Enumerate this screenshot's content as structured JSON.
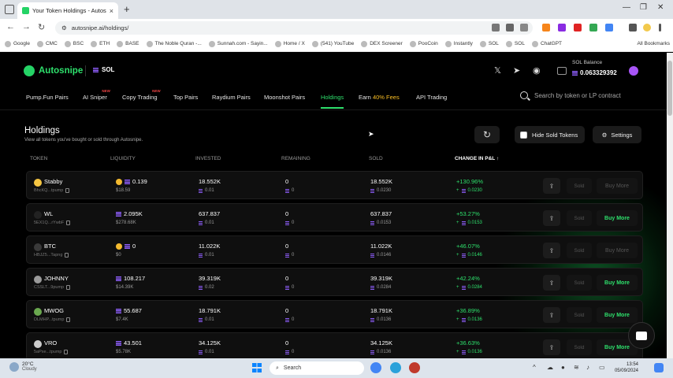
{
  "browser": {
    "tab_title": "Your Token Holdings - Autosnipe",
    "tab_close": "×",
    "new_tab": "+",
    "url": "autosnipe.ai/holdings/",
    "bookmarks": [
      "Google",
      "CMC",
      "BSC",
      "ETH",
      "BASE",
      "The Noble Quran -...",
      "Sunnah.com - Sayin...",
      "Home / X",
      "(541) YouTube",
      "DEX Screener",
      "PooCoin",
      "Instantly",
      "SOL",
      "SOL",
      "ChatGPT"
    ],
    "all_bookmarks": "All Bookmarks"
  },
  "header": {
    "brand": "Autosnipe",
    "chain": "SOL",
    "balance_label": "SOL Balance",
    "balance_value": "0.063329392"
  },
  "nav": {
    "items": [
      {
        "label": "Pump.Fun Pairs",
        "new": ""
      },
      {
        "label": "AI Sniper",
        "new": "NEW"
      },
      {
        "label": "Copy Trading",
        "new": "NEW"
      },
      {
        "label": "Top Pairs",
        "new": ""
      },
      {
        "label": "Raydium Pairs",
        "new": ""
      },
      {
        "label": "Moonshot Pairs",
        "new": ""
      },
      {
        "label": "Holdings",
        "new": ""
      },
      {
        "label_a": "Earn ",
        "label_b": "40% Fees",
        "new": ""
      },
      {
        "label": "API Trading",
        "new": ""
      }
    ],
    "search_placeholder": "Search by token or LP contract"
  },
  "holdings": {
    "title": "Holdings",
    "subtitle": "View all tokens you've bought or sold through Autosnipe.",
    "refresh_icon": "↻",
    "hide_sold_label": "Hide Sold Tokens",
    "settings_label": "Settings",
    "settings_icon": "⚙",
    "columns": {
      "token": "TOKEN",
      "liquidity": "LIQUIDITY",
      "invested": "INVESTED",
      "remaining": "REMAINING",
      "sold": "SOLD",
      "change": "CHANGE IN P&L ↑"
    },
    "rows": [
      {
        "name": "Stabby",
        "addr": "BhcKQ...tpump",
        "liq": "0.139",
        "liq_usd": "$18.59",
        "invested": "18.552K",
        "invested_sol": "0.01",
        "remaining": "0",
        "remaining_sol": "0",
        "sold": "18.552K",
        "sold_sol": "0.0230",
        "pnl": "+130.96%",
        "pnl_sol": "0.0230",
        "sold_btn": "Sold",
        "buy_btn": "Buy More",
        "buy_enabled": false,
        "icon_color": "#f5c542",
        "bnb": true
      },
      {
        "name": "WL",
        "addr": "5EX1Q...rYwbF",
        "liq": "2.095K",
        "liq_usd": "$278.68K",
        "invested": "637.837",
        "invested_sol": "0.01",
        "remaining": "0",
        "remaining_sol": "0",
        "sold": "637.837",
        "sold_sol": "0.0153",
        "pnl": "+53.27%",
        "pnl_sol": "0.0153",
        "sold_btn": "Sold",
        "buy_btn": "Buy More",
        "buy_enabled": true,
        "icon_color": "#222222",
        "bnb": false
      },
      {
        "name": "BTC",
        "addr": "HBJZ5...Tapng",
        "liq": "0",
        "liq_usd": "$0",
        "invested": "11.022K",
        "invested_sol": "0.01",
        "remaining": "0",
        "remaining_sol": "0",
        "sold": "11.022K",
        "sold_sol": "0.0146",
        "pnl": "+46.07%",
        "pnl_sol": "0.0146",
        "sold_btn": "Sold",
        "buy_btn": "Buy More",
        "buy_enabled": false,
        "icon_color": "#3a3a3a",
        "bnb": true
      },
      {
        "name": "JOHNNY",
        "addr": "CSSLT...9pump",
        "liq": "108.217",
        "liq_usd": "$14.39K",
        "invested": "39.319K",
        "invested_sol": "0.02",
        "remaining": "0",
        "remaining_sol": "0",
        "sold": "39.319K",
        "sold_sol": "0.0284",
        "pnl": "+42.24%",
        "pnl_sol": "0.0284",
        "sold_btn": "Sold",
        "buy_btn": "Buy More",
        "buy_enabled": true,
        "icon_color": "#9a9a9a",
        "bnb": false
      },
      {
        "name": "MWOG",
        "addr": "DLMHP...tpump",
        "liq": "55.687",
        "liq_usd": "$7.4K",
        "invested": "18.791K",
        "invested_sol": "0.01",
        "remaining": "0",
        "remaining_sol": "0",
        "sold": "18.791K",
        "sold_sol": "0.0136",
        "pnl": "+36.89%",
        "pnl_sol": "0.0136",
        "sold_btn": "Sold",
        "buy_btn": "Buy More",
        "buy_enabled": true,
        "icon_color": "#6aa84f",
        "bnb": false
      },
      {
        "name": "VRO",
        "addr": "5aPxe...tpump",
        "liq": "43.501",
        "liq_usd": "$5.78K",
        "invested": "34.125K",
        "invested_sol": "0.01",
        "remaining": "0",
        "remaining_sol": "0",
        "sold": "34.125K",
        "sold_sol": "0.0136",
        "pnl": "+36.63%",
        "pnl_sol": "0.0136",
        "sold_btn": "Sold",
        "buy_btn": "Buy More",
        "buy_enabled": true,
        "icon_color": "#cccccc",
        "bnb": false
      }
    ]
  },
  "taskbar": {
    "temp": "20°C",
    "condition": "Cloudy",
    "search_label": "Search",
    "time": "13:54",
    "date": "05/09/2024"
  }
}
